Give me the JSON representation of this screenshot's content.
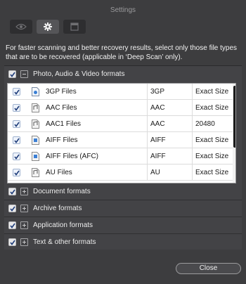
{
  "window": {
    "title": "Settings"
  },
  "tabs": [
    {
      "icon": "eye-icon"
    },
    {
      "icon": "gear-icon",
      "active": true
    },
    {
      "icon": "window-icon"
    }
  ],
  "description": "For faster scanning and better recovery results, select only those file types that are to be recovered (applicable in ‘Deep Scan’ only).",
  "sections": [
    {
      "label": "Photo, Audio & Video formats",
      "checked": true,
      "expanded": true
    },
    {
      "label": "Document formats",
      "checked": true,
      "expanded": false
    },
    {
      "label": "Archive formats",
      "checked": true,
      "expanded": false
    },
    {
      "label": "Application formats",
      "checked": true,
      "expanded": false
    },
    {
      "label": "Text & other formats",
      "checked": true,
      "expanded": false
    }
  ],
  "files": [
    {
      "name": "3GP Files",
      "ext": "3GP",
      "size": "Exact Size",
      "checked": true
    },
    {
      "name": "AAC Files",
      "ext": "AAC",
      "size": "Exact Size",
      "checked": true
    },
    {
      "name": "AAC1 Files",
      "ext": "AAC",
      "size": "20480",
      "checked": true
    },
    {
      "name": "AIFF Files",
      "ext": "AIFF",
      "size": "Exact Size",
      "checked": true
    },
    {
      "name": "AIFF Files (AFC)",
      "ext": "AIFF",
      "size": "Exact Size",
      "checked": true
    },
    {
      "name": "AU Files",
      "ext": "AU",
      "size": "Exact Size",
      "checked": true
    }
  ],
  "buttons": {
    "close": "Close"
  }
}
